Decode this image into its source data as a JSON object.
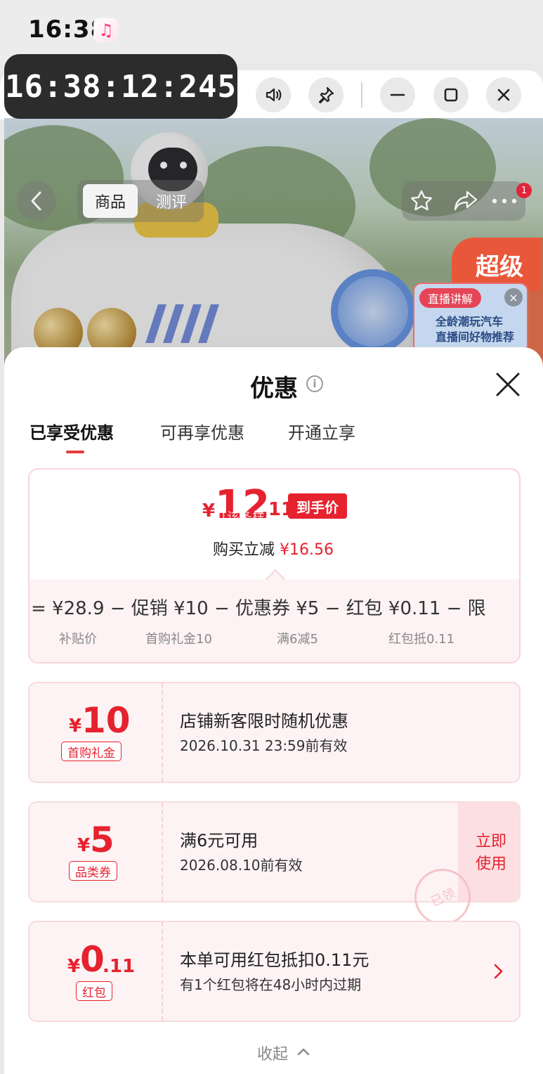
{
  "status_bar": {
    "time": "16:38",
    "app_icon": "music-note-icon"
  },
  "overlay_clock": "16:38:12:245",
  "window_controls": [
    "volume-icon",
    "pin-icon",
    "minimize-icon",
    "maximize-icon",
    "close-icon"
  ],
  "product_header": {
    "tabs": [
      "商品",
      "测评"
    ],
    "active_tab": "商品",
    "actions": [
      "star-icon",
      "share-icon",
      "more-icon"
    ],
    "notification_count": "1",
    "promo_tag": "超级",
    "live": {
      "label": "直播讲解",
      "line1": "全龄潮玩汽车",
      "line2": "直播间好物推荐"
    }
  },
  "sheet": {
    "title": "优惠",
    "tabs": [
      "已享受优惠",
      "可再享优惠",
      "开通立享"
    ],
    "active_tab": 0,
    "summary": {
      "currency": "¥",
      "price_int": "12",
      "price_dec": ".11",
      "watermark": "[该条样]",
      "price_tag": "到手价",
      "reduce_label": "购买立减",
      "reduce_amount": "¥16.56",
      "formula": "= ¥28.9 − 促销 ¥10 − 优惠券 ¥5 − 红包 ¥0.11 − 限",
      "formula_labels": [
        "补贴价",
        "首购礼金10",
        "满6减5",
        "红包抵0.11"
      ]
    },
    "coupons": [
      {
        "currency": "¥",
        "amount": "10",
        "decimal": "",
        "label": "首购礼金",
        "title": "店铺新客限时随机优惠",
        "subtitle": "2026.10.31 23:59前有效"
      },
      {
        "currency": "¥",
        "amount": "5",
        "decimal": "",
        "label": "品类券",
        "title": "满6元可用",
        "subtitle": "2026.08.10前有效",
        "action": "立即使用",
        "stamp": "已领"
      },
      {
        "currency": "¥",
        "amount": "0",
        "decimal": ".11",
        "label": "红包",
        "title": "本单可用红包抵扣0.11元",
        "subtitle": "有1个红包将在48小时内过期"
      }
    ],
    "collapse_label": "收起"
  },
  "colors": {
    "accent_red": "#e6222f",
    "coupon_bg": "#fdf3f4",
    "overlay_bg": "#2c2c2c"
  }
}
